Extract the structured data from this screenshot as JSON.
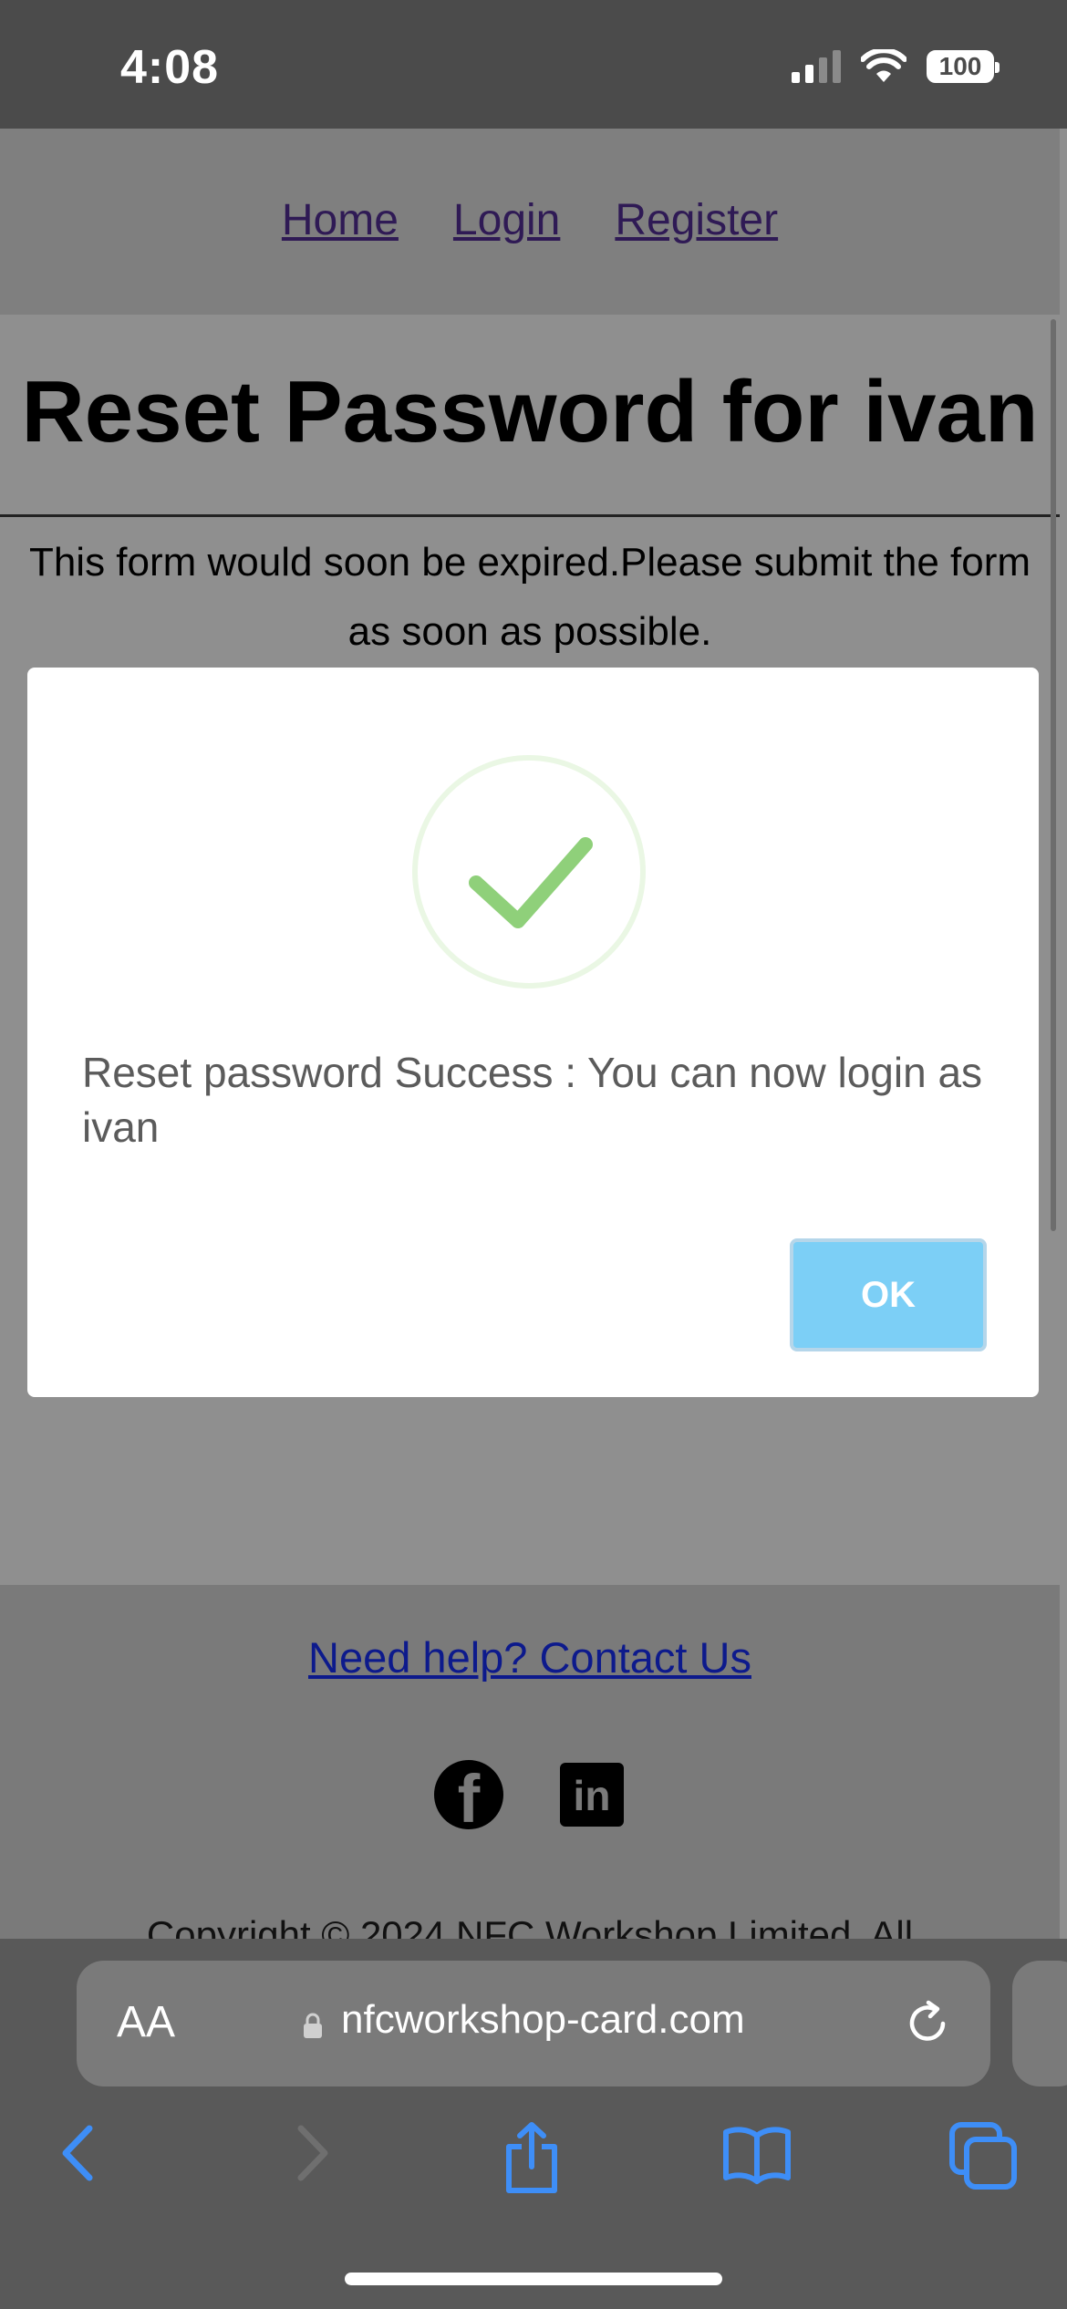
{
  "status_bar": {
    "time": "4:08",
    "battery": "100"
  },
  "nav": {
    "home": "Home",
    "login": "Login",
    "register": "Register"
  },
  "page": {
    "title": "Reset Password for ivan",
    "notice": "This form would soon be expired.Please submit the form as soon as possible."
  },
  "dialog": {
    "message": "Reset password Success : You can now login as ivan",
    "ok_label": "OK",
    "success_color": "#8fd07a",
    "button_color": "#7ccff6"
  },
  "footer": {
    "help_link": "Need help? Contact Us",
    "copyright": "Copyright © 2024 NFC Workshop Limited. All"
  },
  "browser": {
    "text_size_label": "AA",
    "url": "nfcworkshop-card.com",
    "toolbar_icons": [
      "back-icon",
      "forward-icon",
      "share-icon",
      "bookmarks-icon",
      "tabs-icon"
    ]
  }
}
